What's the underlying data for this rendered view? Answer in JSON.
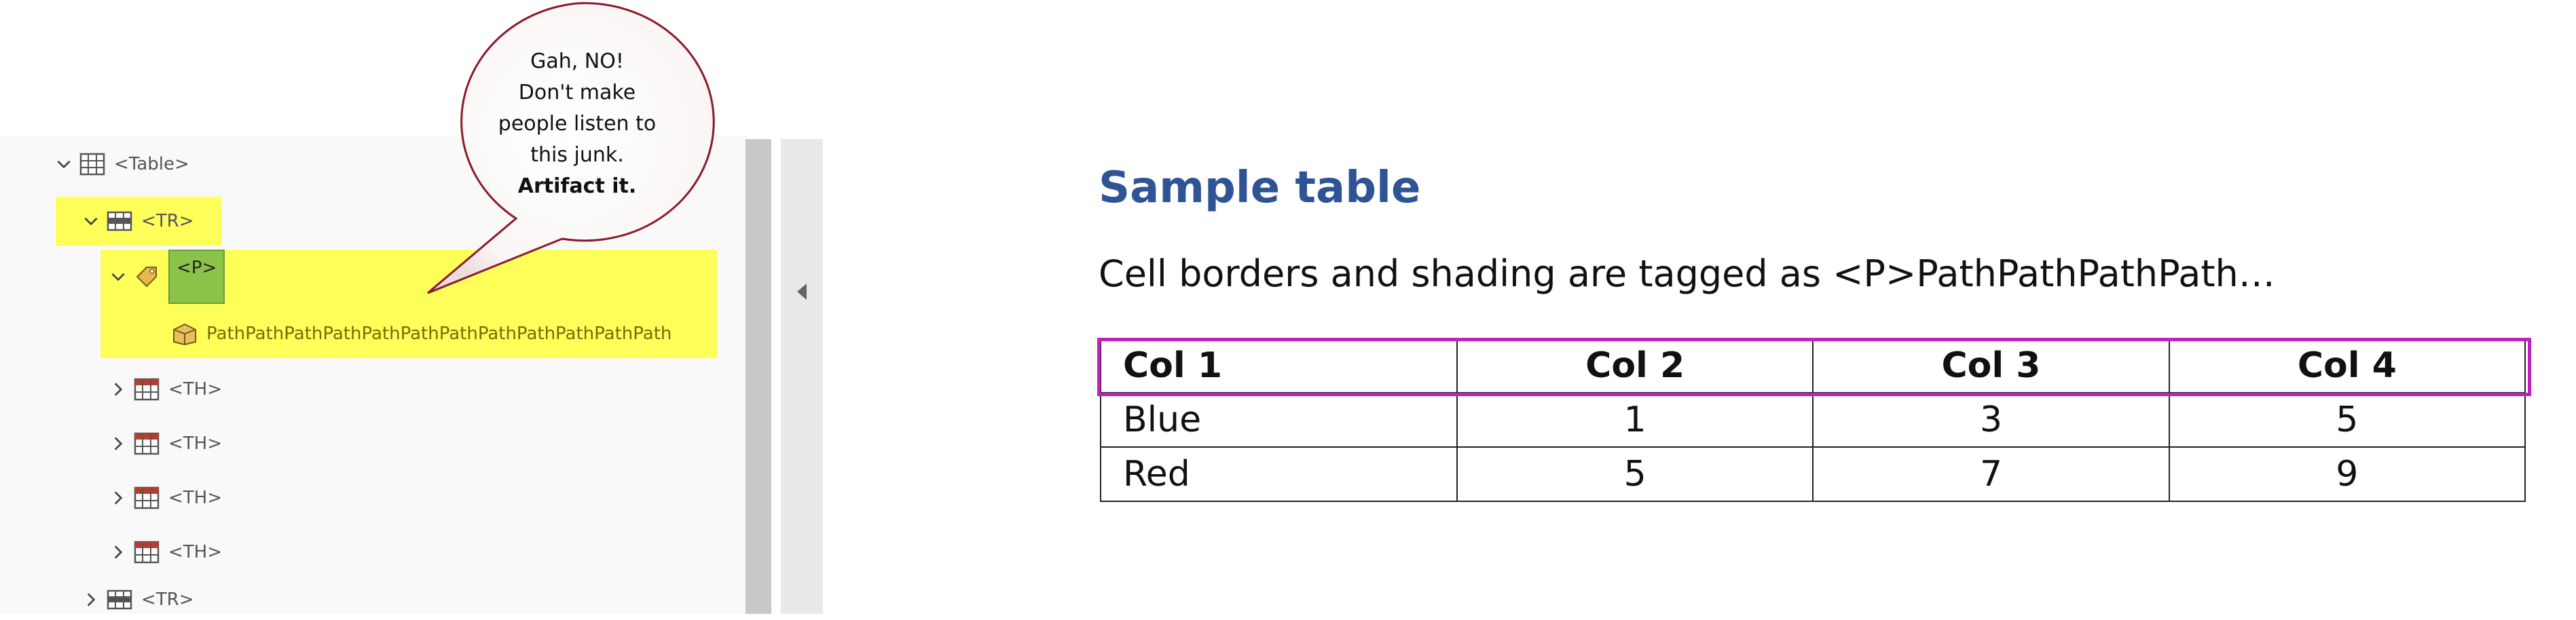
{
  "tags_tree": {
    "table_label": "<Table>",
    "tr_label": "<TR>",
    "p_label": "<P>",
    "path_content": "PathPathPathPathPathPathPathPathPathPathPathPath",
    "th_labels": [
      "<TH>",
      "<TH>",
      "<TH>",
      "<TH>"
    ],
    "tr2_label": "<TR>"
  },
  "bubble": {
    "line1": "Gah, NO!",
    "line2": "Don't make",
    "line3": "people listen to",
    "line4": "this  junk.",
    "line5": "Artifact it."
  },
  "document": {
    "heading": "Sample table",
    "paragraph": "Cell borders and shading are tagged as <P>PathPathPathPath…",
    "table": {
      "headers": [
        "Col 1",
        "Col 2",
        "Col 3",
        "Col 4"
      ],
      "rows": [
        [
          "Blue",
          "1",
          "3",
          "5"
        ],
        [
          "Red",
          "5",
          "7",
          "9"
        ]
      ]
    }
  },
  "colors": {
    "highlight": "#ffff5a",
    "heading": "#2f5496",
    "table_outline": "#c020c0",
    "p_tag_box": "#8bc34a"
  },
  "icons": [
    "chevron-down-icon",
    "chevron-right-icon",
    "table-icon",
    "table-row-icon",
    "tag-icon",
    "path-content-icon",
    "table-header-cell-icon",
    "collapse-arrow-icon"
  ]
}
